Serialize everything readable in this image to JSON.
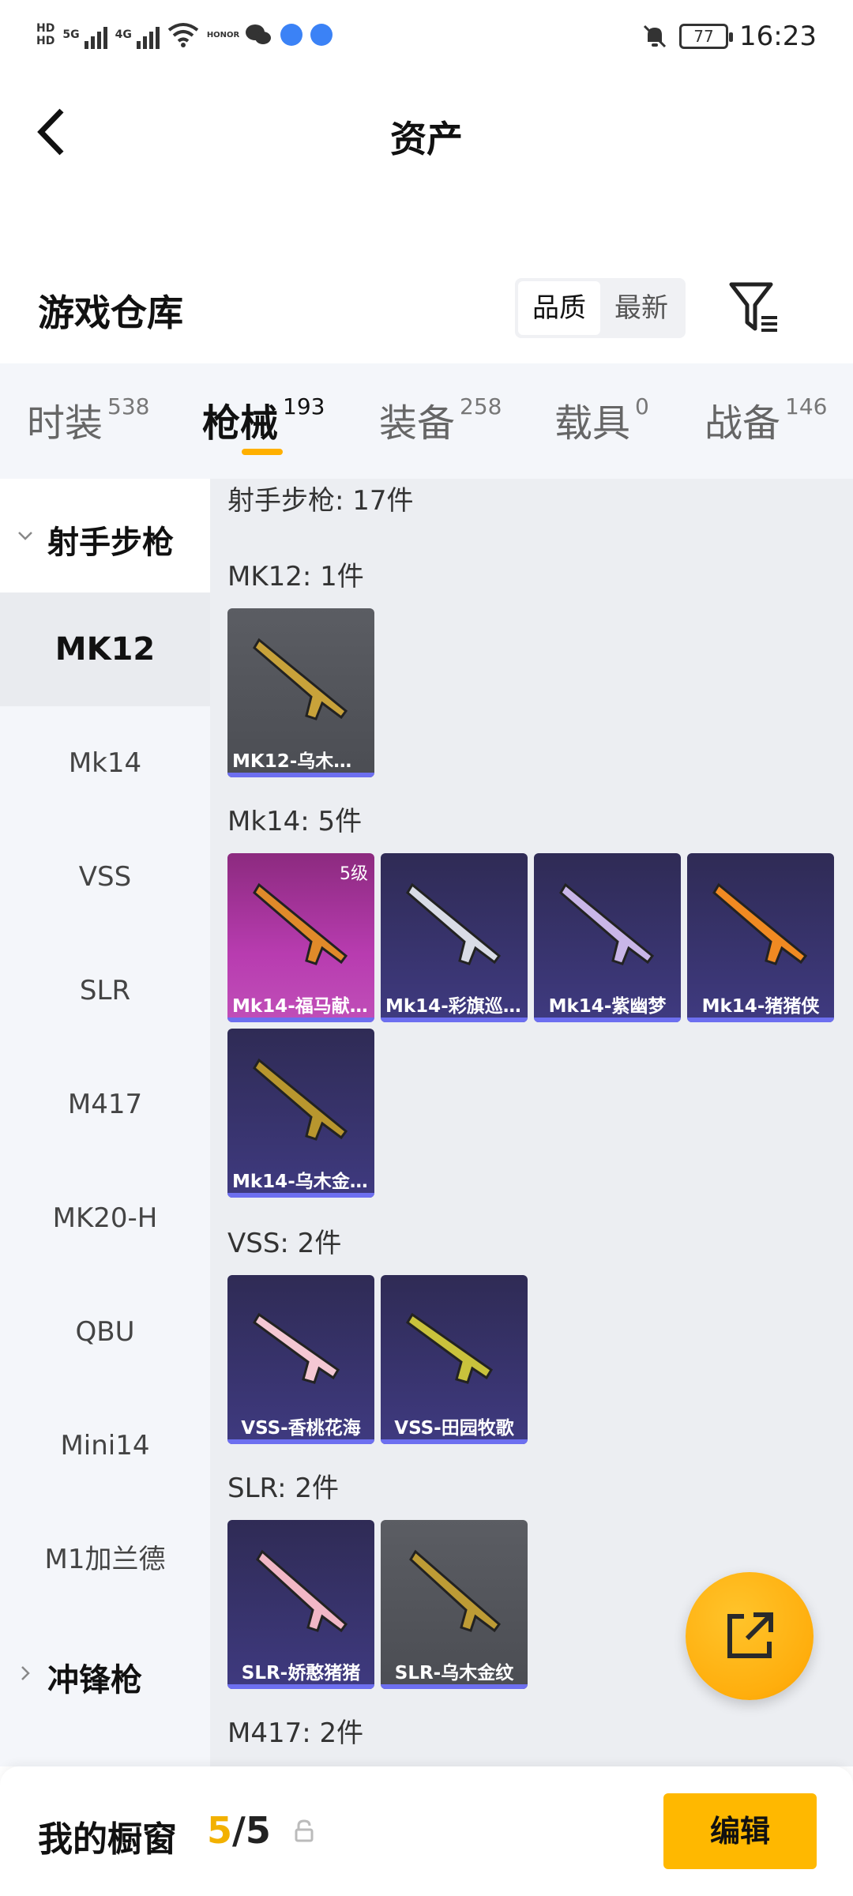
{
  "status_bar": {
    "hd1": "HD",
    "hd2": "HD",
    "net1": "5G",
    "net2": "4G",
    "brand_tag": "HONOR",
    "battery": "77",
    "time": "16:23"
  },
  "header": {
    "title": "资产"
  },
  "warehouse": {
    "title": "游戏仓库",
    "sort_options": [
      "品质",
      "最新"
    ],
    "active_sort": "品质"
  },
  "tabs": [
    {
      "label": "时装",
      "count": "538"
    },
    {
      "label": "枪械",
      "count": "193"
    },
    {
      "label": "装备",
      "count": "258"
    },
    {
      "label": "载具",
      "count": "0"
    },
    {
      "label": "战备",
      "count": "146"
    }
  ],
  "sidebar": {
    "group_open": "射手步枪",
    "items": [
      "MK12",
      "Mk14",
      "VSS",
      "SLR",
      "M417",
      "MK20-H",
      "QBU",
      "Mini14",
      "M1加兰德"
    ],
    "active_item": "MK12",
    "group_closed": "冲锋枪"
  },
  "content": {
    "category_total": "射手步枪: 17件",
    "sections": [
      {
        "label": "MK12: 1件",
        "items": [
          {
            "name": "MK12-乌木金..."
          }
        ]
      },
      {
        "label": "Mk14: 5件",
        "items": [
          {
            "name": "Mk14-福马献...",
            "level": "5级"
          },
          {
            "name": "Mk14-彩旗巡..."
          },
          {
            "name": "Mk14-紫幽梦"
          },
          {
            "name": "Mk14-猪猪侠"
          },
          {
            "name": "Mk14-乌木金..."
          }
        ]
      },
      {
        "label": "VSS: 2件",
        "items": [
          {
            "name": "VSS-香桃花海"
          },
          {
            "name": "VSS-田园牧歌"
          }
        ]
      },
      {
        "label": "SLR: 2件",
        "items": [
          {
            "name": "SLR-娇憨猪猪"
          },
          {
            "name": "SLR-乌木金纹"
          }
        ]
      },
      {
        "label": "M417: 2件",
        "items": []
      }
    ]
  },
  "bottom_bar": {
    "title": "我的橱窗",
    "count_current": "5",
    "count_sep": "/",
    "count_total": "5",
    "edit_label": "编辑"
  },
  "colors": {
    "accent": "#ffb800",
    "card_rare": "#3f3a80",
    "card_epic": "#b83cb0",
    "card_common": "#4b4d53"
  }
}
